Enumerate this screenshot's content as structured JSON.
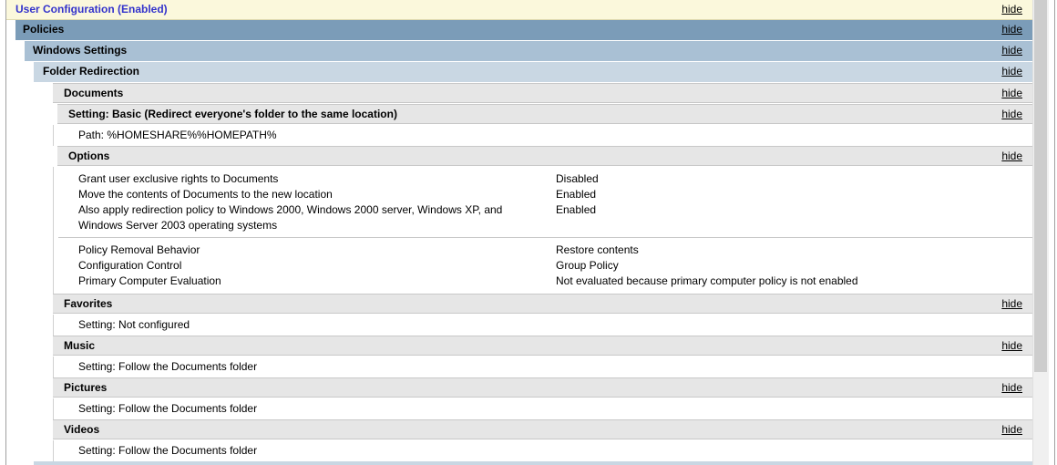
{
  "hide_label": "hide",
  "headers": {
    "user_config": "User Configuration (Enabled)",
    "policies": "Policies",
    "windows_settings": "Windows Settings",
    "folder_redirection": "Folder Redirection"
  },
  "documents": {
    "title": "Documents",
    "setting_title": "Setting: Basic (Redirect everyone's folder to the same location)",
    "path": "Path: %HOMESHARE%%HOMEPATH%",
    "options_title": "Options",
    "options": [
      {
        "name": "Grant user exclusive rights to Documents",
        "value": "Disabled"
      },
      {
        "name": "Move the contents of Documents to the new location",
        "value": "Enabled"
      },
      {
        "name": "Also apply redirection policy to Windows 2000, Windows 2000 server, Windows XP, and Windows Server 2003 operating systems",
        "value": "Enabled"
      }
    ],
    "behaviors": [
      {
        "name": "Policy Removal Behavior",
        "value": "Restore contents"
      },
      {
        "name": "Configuration Control",
        "value": "Group Policy"
      },
      {
        "name": "Primary Computer Evaluation",
        "value": "Not evaluated because primary computer policy is not enabled"
      }
    ]
  },
  "favorites": {
    "title": "Favorites",
    "setting": "Setting: Not configured"
  },
  "music": {
    "title": "Music",
    "setting": "Setting: Follow the Documents folder"
  },
  "pictures": {
    "title": "Pictures",
    "setting": "Setting: Follow the Documents folder"
  },
  "videos": {
    "title": "Videos",
    "setting": "Setting: Follow the Documents folder"
  }
}
